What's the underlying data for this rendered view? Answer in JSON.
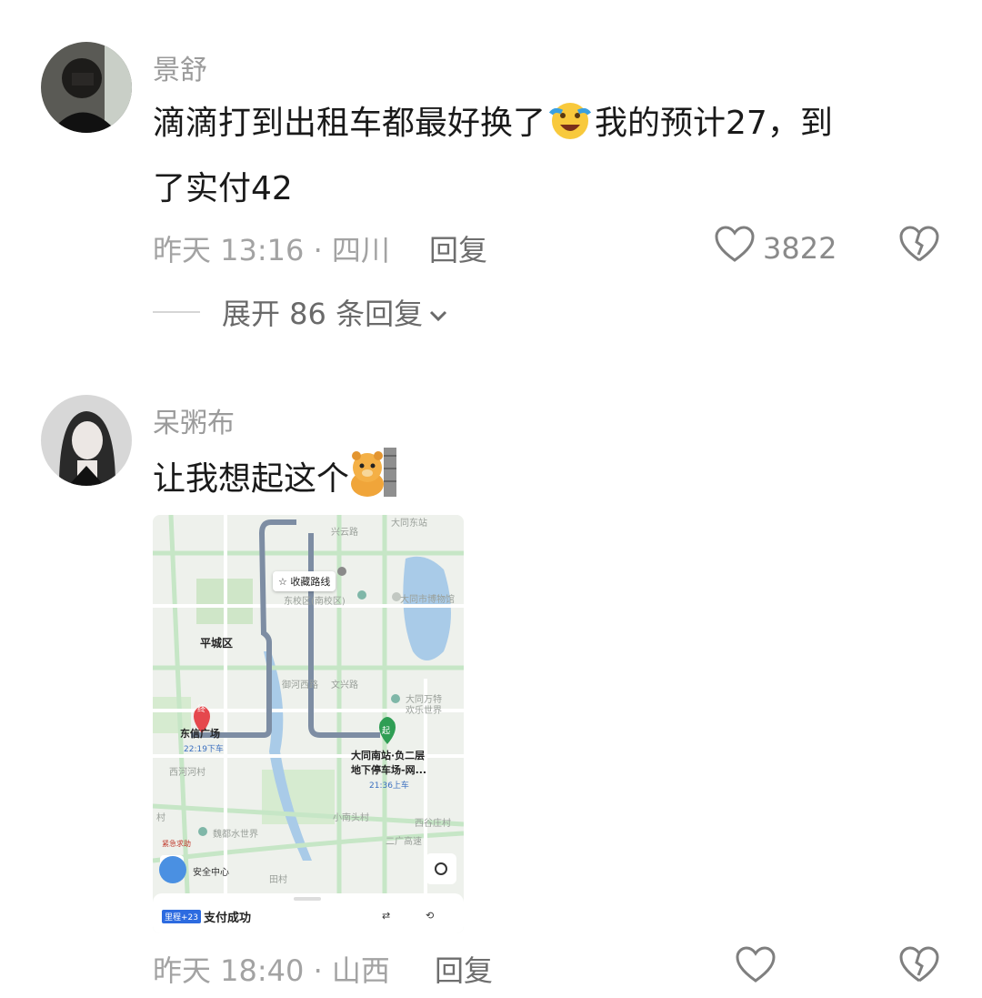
{
  "comments": [
    {
      "username": "景舒",
      "text_part1": "滴滴打到出租车都最好换了",
      "text_part2": "我的预计27，到",
      "text_line2": "了实付42",
      "emoji": "crying-laughing-emoji",
      "time_location": "昨天 13:16 · 四川",
      "reply_label": "回复",
      "like_count": "3822",
      "expand_label": "展开 86 条回复"
    },
    {
      "username": "呆粥布",
      "text": "让我想起这个",
      "emoji": "peeking-bear-emoji",
      "time_location": "昨天 18:40 · 山西",
      "reply_label": "回复",
      "like_count": "",
      "map": {
        "fav_route": "收藏路线",
        "district": "平城区",
        "end_label": "终",
        "end_place": "东信广场",
        "end_time": "22:19下车",
        "start_label": "起",
        "start_place_line1": "大同南站·负二层",
        "start_place_line2": "地下停车场-网...",
        "start_time": "21:36上车",
        "museum": "大同市博物馆",
        "campus": "东校区(南校区)",
        "park_line1": "大同万特",
        "park_line2": "欢乐世界",
        "xinhe": "西河河村",
        "xiao_nan": "小南头村",
        "xigu": "西谷庄村",
        "water_world": "魏都水世界",
        "highway": "二广高速",
        "tian": "田村",
        "cun": "村",
        "road1": "兴云路",
        "road2": "文兴路",
        "road3": "御河西路",
        "datong_north": "大同东站",
        "emergency": "紧急求助",
        "safety": "安全中心",
        "badge": "里程+23",
        "pay_status": "支付成功"
      }
    }
  ],
  "colors": {
    "route": "#7d8da3",
    "start_pin": "#2f9e54",
    "end_pin": "#e5484d",
    "water": "#a9cbe8",
    "green_area": "#cfe6c8"
  }
}
